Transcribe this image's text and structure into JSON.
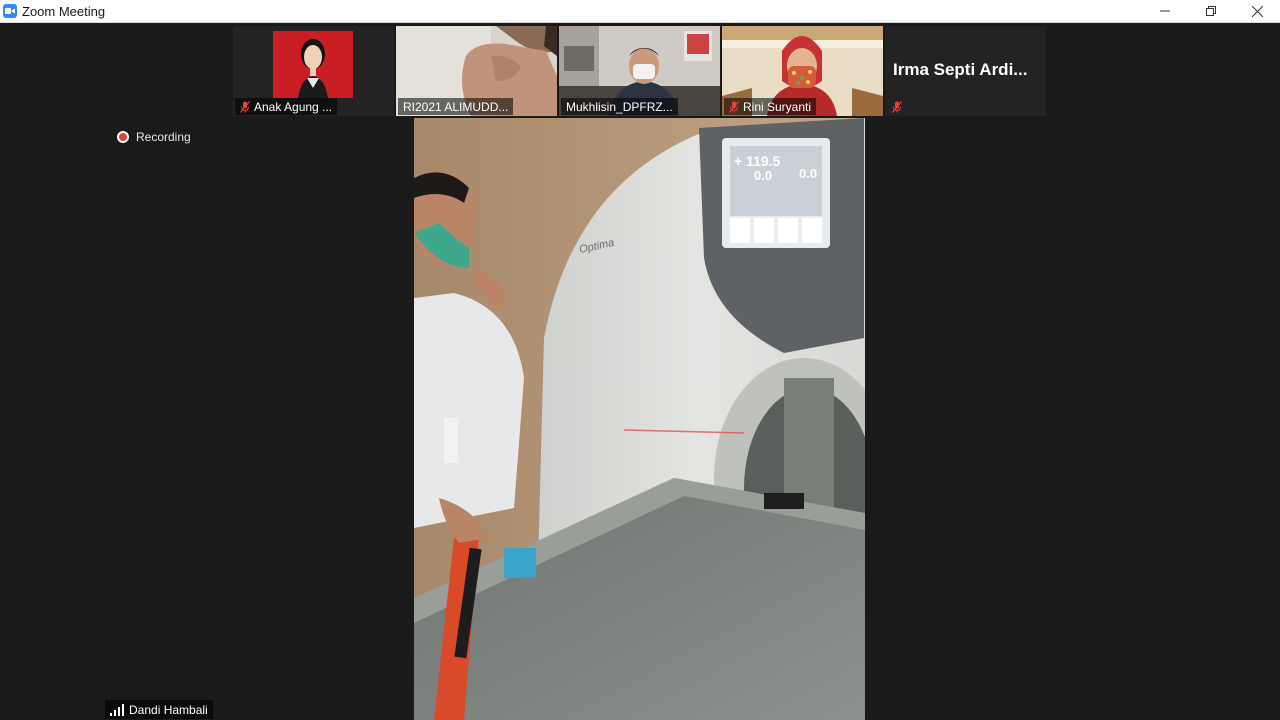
{
  "window": {
    "title": "Zoom Meeting"
  },
  "recording": {
    "label": "Recording"
  },
  "participants": [
    {
      "name": "Anak Agung ...",
      "muted": true
    },
    {
      "name": "RI2021 ALIMUDD...",
      "muted": false
    },
    {
      "name": "Mukhlisin_DPFRZ...",
      "muted": false
    },
    {
      "name": "Rini Suryanti",
      "muted": true
    },
    {
      "name": "Irma  Septi  Ardi...",
      "muted": true
    }
  ],
  "active_speaker": {
    "name": "Dandi Hambali"
  },
  "scanner_screen": {
    "reading_main": "+ 119.5",
    "reading_left": "0.0",
    "reading_right": "0.0"
  },
  "machine_brand": "Optima",
  "colors": {
    "titlebar_bg": "#ffffff",
    "stage_bg": "#1a1a1a",
    "accent": "#2d8cff",
    "muted_icon": "#e8403b",
    "recording": "#e8403b"
  },
  "icons": {
    "app": "zoom-camera-icon",
    "minimize": "minimize-icon",
    "restore": "restore-icon",
    "close": "close-icon",
    "muted": "mic-muted-icon",
    "signal": "signal-bars-icon"
  }
}
